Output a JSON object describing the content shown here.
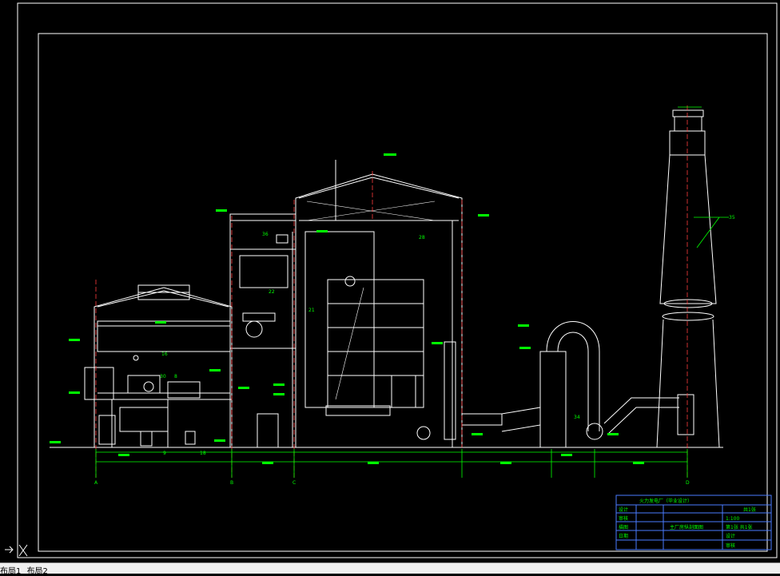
{
  "drawing": {
    "callouts": [
      "16",
      "22",
      "21",
      "28",
      "30",
      "9",
      "8",
      "18",
      "34",
      "35",
      "36"
    ],
    "axis_labels": [
      "A",
      "B",
      "C",
      "D"
    ]
  },
  "title_block": {
    "header": "火力发电厂（毕业设计）",
    "right_top": "共1张",
    "right_rows": [
      "1:100",
      "第1张 共1张",
      "设计",
      "审核"
    ],
    "left_rows": [
      "设计",
      "审核",
      "描图",
      "日期"
    ],
    "center_title": "主厂房纵剖面图"
  },
  "tabs": [
    "布局1",
    "布局2"
  ],
  "colors": {
    "line": "#ffffff",
    "dimension": "#00ff00",
    "axis": "#ff3b3b",
    "titleblock": "#4a7bff"
  },
  "icons": [
    "ucs-icon"
  ]
}
